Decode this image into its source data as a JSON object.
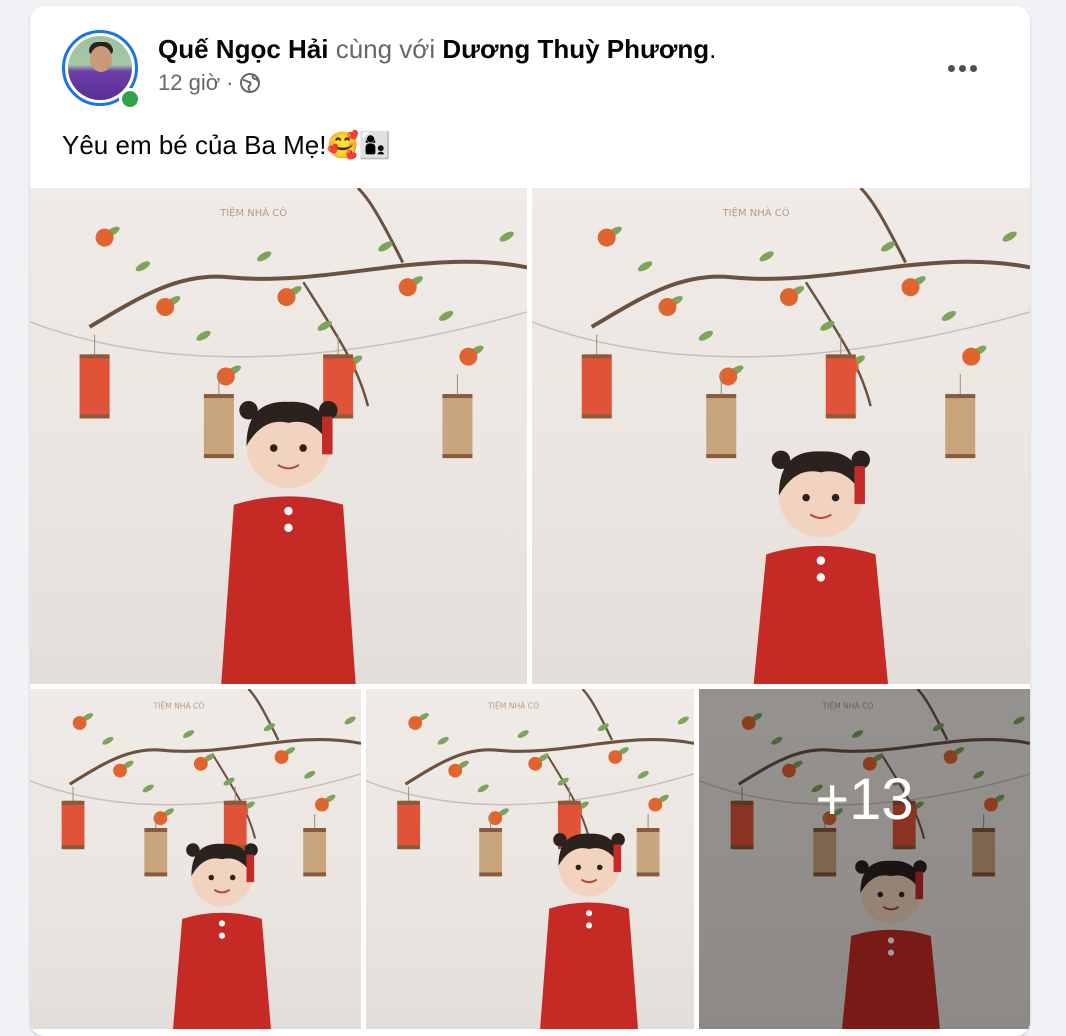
{
  "post": {
    "author": "Quế Ngọc Hải",
    "with_text": " cùng với ",
    "tagged": "Dương Thuỳ Phương",
    "period": ".",
    "time": "12 giờ",
    "separator": "·",
    "privacy_icon": "globe-icon",
    "more_icon": "more-options-icon",
    "caption_text": "Yêu em bé của Ba Mẹ!",
    "caption_emoji": "🥰👩‍👦",
    "watermark": "TIỆM NHÀ CÒ",
    "more_photos": "+13"
  },
  "colors": {
    "accent": "#1b74e4",
    "online": "#31a24c",
    "text": "#050505",
    "muted": "#65676b",
    "dress": "#c62a24"
  }
}
